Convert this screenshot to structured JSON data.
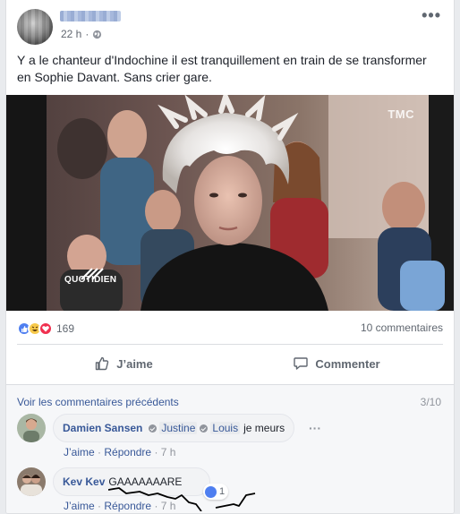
{
  "post": {
    "time": "22 h",
    "time_separator": "·",
    "text": "Y a le chanteur d'Indochine il est tranquillement en train de se transformer en Sophie Davant. Sans crier gare.",
    "video": {
      "channel_watermark": "TMC",
      "show_logo": "QUOTIDIEN"
    }
  },
  "reactions": {
    "count": "169",
    "types": [
      "like-icon",
      "haha-icon",
      "love-icon"
    ],
    "comments_count": "10 commentaires"
  },
  "actions": {
    "like_label": "J’aime",
    "comment_label": "Commenter"
  },
  "comments": {
    "previous_link": "Voir les commentaires précédents",
    "pager": "3/10",
    "items": [
      {
        "author": "Damien Sansen",
        "tags": [
          "Justine",
          "Louis"
        ],
        "text": "je meurs",
        "like": "J’aime",
        "reply": "Répondre",
        "sep": "·",
        "time": "7 h"
      },
      {
        "author": "Kev Kev",
        "text": "GAAAAAAARE",
        "likes": "1",
        "like": "J’aime",
        "reply": "Répondre",
        "sep": "·",
        "time": "7 h"
      }
    ]
  },
  "colors": {
    "link": "#385898",
    "like_blue": "#4f7ff0",
    "love_red": "#f0304f",
    "haha_yellow": "#f7c94b"
  }
}
